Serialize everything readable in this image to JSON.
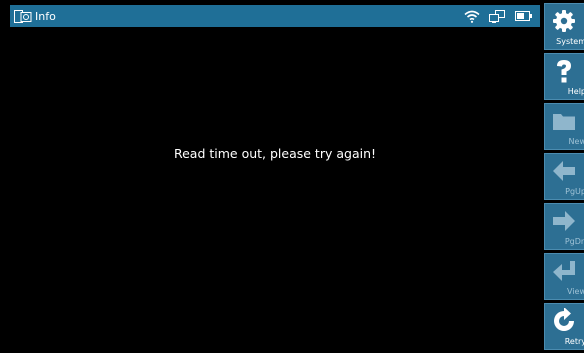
{
  "window": {
    "title": "Info",
    "title_icon": "info-window-icon"
  },
  "status_bar": {
    "icons": [
      "wifi-icon",
      "network-icon",
      "battery-icon"
    ]
  },
  "content": {
    "message": "Read time out, please try again!"
  },
  "sidebar": {
    "buttons": [
      {
        "label": "System",
        "icon": "gear-icon",
        "enabled": true
      },
      {
        "label": "Help",
        "icon": "question-icon",
        "enabled": true
      },
      {
        "label": "New",
        "icon": "folder-icon",
        "enabled": false
      },
      {
        "label": "PgUp",
        "icon": "arrow-left-icon",
        "enabled": false
      },
      {
        "label": "PgDn",
        "icon": "arrow-right-icon",
        "enabled": false
      },
      {
        "label": "View",
        "icon": "return-icon",
        "enabled": false
      },
      {
        "label": "Retry",
        "icon": "retry-icon",
        "enabled": true
      }
    ]
  },
  "colors": {
    "titlebar": "#1f6f97",
    "sidebar_button": "#2d6f93",
    "background": "#000000",
    "text": "#ffffff"
  }
}
